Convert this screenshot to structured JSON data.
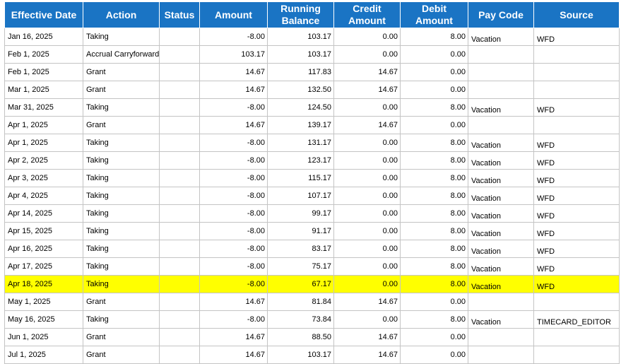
{
  "columns": [
    "Effective Date",
    "Action",
    "Status",
    "Amount",
    "Running Balance",
    "Credit Amount",
    "Debit Amount",
    "Pay Code",
    "Source"
  ],
  "highlight_color": "#ffff00",
  "header_color": "#1a74c4",
  "rows": [
    {
      "date": "Jan 16, 2025",
      "action": "Taking",
      "status": "",
      "amount": "-8.00",
      "balance": "103.17",
      "credit": "0.00",
      "debit": "8.00",
      "paycode": "Vacation",
      "source": "WFD",
      "highlight": false
    },
    {
      "date": "Feb 1, 2025",
      "action": "Accrual Carryforward",
      "status": "",
      "amount": "103.17",
      "balance": "103.17",
      "credit": "0.00",
      "debit": "0.00",
      "paycode": "",
      "source": "",
      "highlight": false
    },
    {
      "date": "Feb 1, 2025",
      "action": "Grant",
      "status": "",
      "amount": "14.67",
      "balance": "117.83",
      "credit": "14.67",
      "debit": "0.00",
      "paycode": "",
      "source": "",
      "highlight": false
    },
    {
      "date": "Mar 1, 2025",
      "action": "Grant",
      "status": "",
      "amount": "14.67",
      "balance": "132.50",
      "credit": "14.67",
      "debit": "0.00",
      "paycode": "",
      "source": "",
      "highlight": false
    },
    {
      "date": "Mar 31, 2025",
      "action": "Taking",
      "status": "",
      "amount": "-8.00",
      "balance": "124.50",
      "credit": "0.00",
      "debit": "8.00",
      "paycode": "Vacation",
      "source": "WFD",
      "highlight": false
    },
    {
      "date": "Apr 1, 2025",
      "action": "Grant",
      "status": "",
      "amount": "14.67",
      "balance": "139.17",
      "credit": "14.67",
      "debit": "0.00",
      "paycode": "",
      "source": "",
      "highlight": false
    },
    {
      "date": "Apr 1, 2025",
      "action": "Taking",
      "status": "",
      "amount": "-8.00",
      "balance": "131.17",
      "credit": "0.00",
      "debit": "8.00",
      "paycode": "Vacation",
      "source": "WFD",
      "highlight": false
    },
    {
      "date": "Apr 2, 2025",
      "action": "Taking",
      "status": "",
      "amount": "-8.00",
      "balance": "123.17",
      "credit": "0.00",
      "debit": "8.00",
      "paycode": "Vacation",
      "source": "WFD",
      "highlight": false
    },
    {
      "date": "Apr 3, 2025",
      "action": "Taking",
      "status": "",
      "amount": "-8.00",
      "balance": "115.17",
      "credit": "0.00",
      "debit": "8.00",
      "paycode": "Vacation",
      "source": "WFD",
      "highlight": false
    },
    {
      "date": "Apr 4, 2025",
      "action": "Taking",
      "status": "",
      "amount": "-8.00",
      "balance": "107.17",
      "credit": "0.00",
      "debit": "8.00",
      "paycode": "Vacation",
      "source": "WFD",
      "highlight": false
    },
    {
      "date": "Apr 14, 2025",
      "action": "Taking",
      "status": "",
      "amount": "-8.00",
      "balance": "99.17",
      "credit": "0.00",
      "debit": "8.00",
      "paycode": "Vacation",
      "source": "WFD",
      "highlight": false
    },
    {
      "date": "Apr 15, 2025",
      "action": "Taking",
      "status": "",
      "amount": "-8.00",
      "balance": "91.17",
      "credit": "0.00",
      "debit": "8.00",
      "paycode": "Vacation",
      "source": "WFD",
      "highlight": false
    },
    {
      "date": "Apr 16, 2025",
      "action": "Taking",
      "status": "",
      "amount": "-8.00",
      "balance": "83.17",
      "credit": "0.00",
      "debit": "8.00",
      "paycode": "Vacation",
      "source": "WFD",
      "highlight": false
    },
    {
      "date": "Apr 17, 2025",
      "action": "Taking",
      "status": "",
      "amount": "-8.00",
      "balance": "75.17",
      "credit": "0.00",
      "debit": "8.00",
      "paycode": "Vacation",
      "source": "WFD",
      "highlight": false
    },
    {
      "date": "Apr 18, 2025",
      "action": "Taking",
      "status": "",
      "amount": "-8.00",
      "balance": "67.17",
      "credit": "0.00",
      "debit": "8.00",
      "paycode": "Vacation",
      "source": "WFD",
      "highlight": true
    },
    {
      "date": "May 1, 2025",
      "action": "Grant",
      "status": "",
      "amount": "14.67",
      "balance": "81.84",
      "credit": "14.67",
      "debit": "0.00",
      "paycode": "",
      "source": "",
      "highlight": false
    },
    {
      "date": "May 16, 2025",
      "action": "Taking",
      "status": "",
      "amount": "-8.00",
      "balance": "73.84",
      "credit": "0.00",
      "debit": "8.00",
      "paycode": "Vacation",
      "source": "TIMECARD_EDITOR",
      "highlight": false
    },
    {
      "date": "Jun 1, 2025",
      "action": "Grant",
      "status": "",
      "amount": "14.67",
      "balance": "88.50",
      "credit": "14.67",
      "debit": "0.00",
      "paycode": "",
      "source": "",
      "highlight": false
    },
    {
      "date": "Jul 1, 2025",
      "action": "Grant",
      "status": "",
      "amount": "14.67",
      "balance": "103.17",
      "credit": "14.67",
      "debit": "0.00",
      "paycode": "",
      "source": "",
      "highlight": false
    }
  ]
}
